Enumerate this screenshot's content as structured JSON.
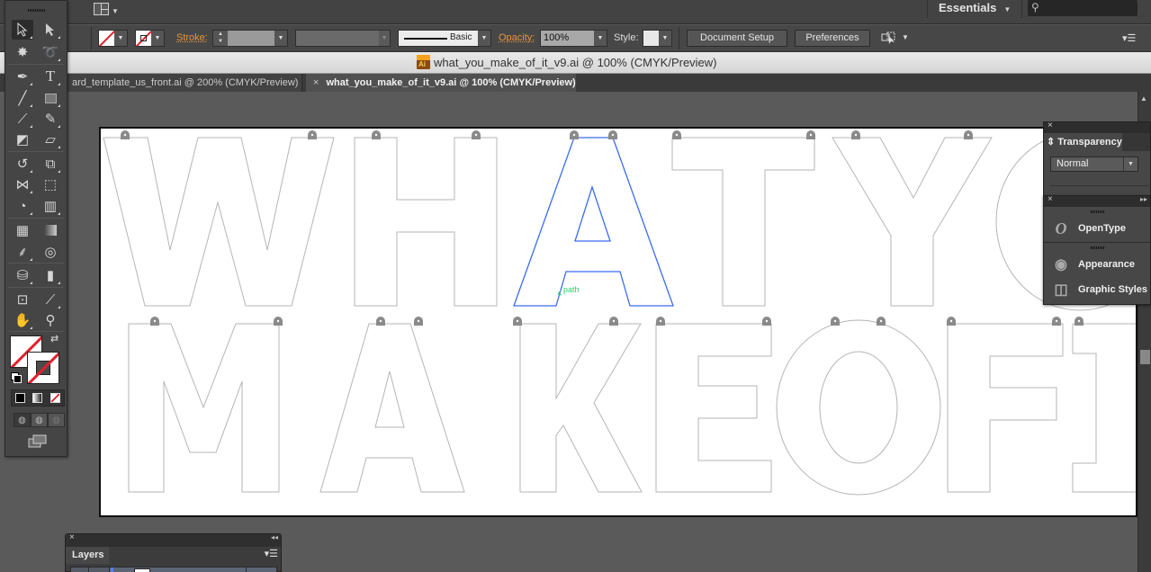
{
  "app": {
    "workspace_label": "Essentials",
    "search_placeholder": ""
  },
  "control_bar": {
    "stroke_label": "Stroke:",
    "stroke_weight": "",
    "brush_label": "Basic",
    "opacity_label": "Opacity:",
    "opacity_value": "100%",
    "style_label": "Style:",
    "document_setup_label": "Document Setup",
    "preferences_label": "Preferences"
  },
  "document": {
    "window_title": "what_you_make_of_it_v9.ai @ 100% (CMYK/Preview)",
    "file_icon_text": "Ai",
    "tabs": [
      {
        "label": "ard_template_us_front.ai @ 200% (CMYK/Preview)",
        "active": false
      },
      {
        "label": "what_you_make_of_it_v9.ai @ 100% (CMYK/Preview)",
        "active": true,
        "close": "×"
      }
    ]
  },
  "canvas": {
    "artwork_lines": [
      "WHATYO",
      "MAKEOFI"
    ],
    "selected_letter": "A",
    "hover_label": "path",
    "selection_color": "#3c6cf0",
    "smart_guide_color": "#22d36b"
  },
  "tools": [
    {
      "name": "selection-tool",
      "glyph": "▲"
    },
    {
      "name": "direct-selection-tool",
      "glyph": "▲"
    },
    {
      "name": "magic-wand-tool",
      "glyph": "✸"
    },
    {
      "name": "lasso-tool",
      "glyph": "➰"
    },
    {
      "name": "pen-tool",
      "glyph": "✒"
    },
    {
      "name": "type-tool",
      "glyph": "T"
    },
    {
      "name": "line-segment-tool",
      "glyph": "╱"
    },
    {
      "name": "rectangle-tool",
      "glyph": "■"
    },
    {
      "name": "paintbrush-tool",
      "glyph": "🖌"
    },
    {
      "name": "pencil-tool",
      "glyph": "✎"
    },
    {
      "name": "blob-brush-tool",
      "glyph": "◩"
    },
    {
      "name": "eraser-tool",
      "glyph": "▱"
    },
    {
      "name": "rotate-tool",
      "glyph": "↻"
    },
    {
      "name": "scale-tool",
      "glyph": "⤢"
    },
    {
      "name": "width-tool",
      "glyph": "⋈"
    },
    {
      "name": "free-transform-tool",
      "glyph": "⬚"
    },
    {
      "name": "shape-builder-tool",
      "glyph": "◔"
    },
    {
      "name": "graph-tool",
      "glyph": "▥"
    },
    {
      "name": "mesh-tool",
      "glyph": "▦"
    },
    {
      "name": "gradient-tool",
      "glyph": "▤"
    },
    {
      "name": "eyedropper-tool",
      "glyph": "⸙"
    },
    {
      "name": "blend-tool",
      "glyph": "◎"
    },
    {
      "name": "symbol-sprayer-tool",
      "glyph": "⛁"
    },
    {
      "name": "column-graph-tool",
      "glyph": "▮"
    },
    {
      "name": "artboard-tool",
      "glyph": "⊡"
    },
    {
      "name": "slice-tool",
      "glyph": "⟋"
    },
    {
      "name": "hand-tool",
      "glyph": "✋"
    },
    {
      "name": "zoom-tool",
      "glyph": "🔍"
    }
  ],
  "panels": {
    "transparency": {
      "title": "Transparency",
      "blend_mode": "Normal"
    },
    "stack": [
      {
        "label": "OpenType",
        "icon": "O"
      },
      {
        "label": "Appearance",
        "icon": "◉"
      },
      {
        "label": "Graphic Styles",
        "icon": "◫"
      }
    ],
    "layers": {
      "title": "Layers"
    }
  }
}
